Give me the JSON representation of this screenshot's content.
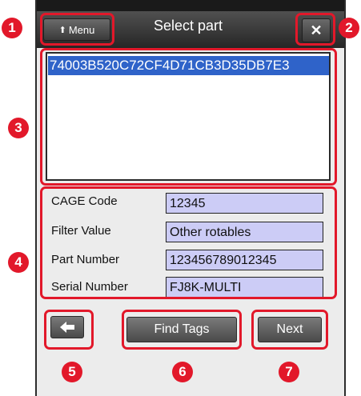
{
  "header": {
    "title": "Select part",
    "menu_label": "Menu",
    "close_glyph": "✕"
  },
  "tags": [
    "74003B520C72CF4D71CB3D35DB7E3"
  ],
  "fields": [
    {
      "label": "CAGE Code",
      "value": "12345"
    },
    {
      "label": "Filter Value",
      "value": "Other rotables"
    },
    {
      "label": "Part Number",
      "value": "123456789012345"
    },
    {
      "label": "Serial Number",
      "value": "FJ8K-MULTI"
    }
  ],
  "buttons": {
    "back_icon": "left-arrow-icon",
    "find_tags": "Find Tags",
    "next": "Next"
  },
  "callouts": [
    "1",
    "2",
    "3",
    "4",
    "5",
    "6",
    "7"
  ],
  "colors": {
    "callout": "#e2182a",
    "selection": "#2f63c9",
    "field_bg": "#ccccf6"
  }
}
